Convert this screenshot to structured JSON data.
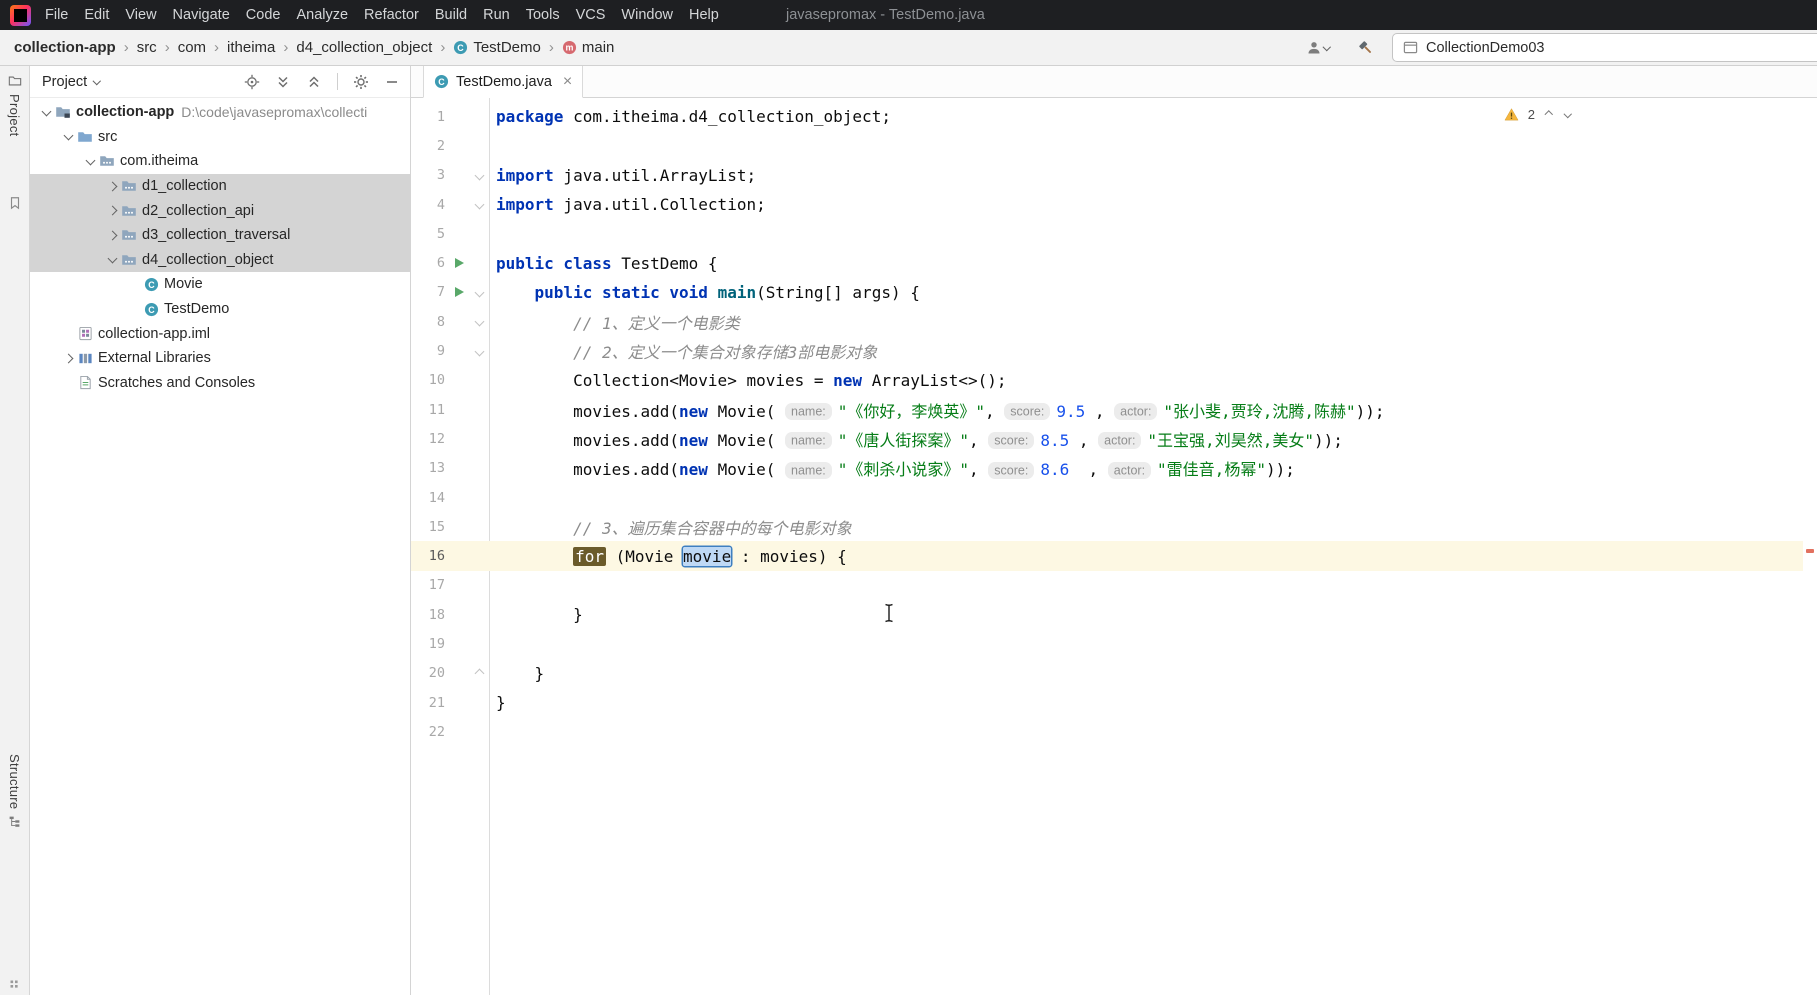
{
  "window": {
    "title": "javasepromax - TestDemo.java"
  },
  "menubar": {
    "items": [
      "File",
      "Edit",
      "View",
      "Navigate",
      "Code",
      "Analyze",
      "Refactor",
      "Build",
      "Run",
      "Tools",
      "VCS",
      "Window",
      "Help"
    ]
  },
  "navbar": {
    "breadcrumbs": [
      {
        "label": "collection-app",
        "bold": true
      },
      {
        "label": "src"
      },
      {
        "label": "com"
      },
      {
        "label": "itheima"
      },
      {
        "label": "d4_collection_object"
      },
      {
        "label": "TestDemo",
        "icon": "class"
      },
      {
        "label": "main",
        "icon": "method"
      }
    ],
    "run_config": "CollectionDemo03"
  },
  "tool_stripes": {
    "left_top": "Project",
    "left_bottom": "Structure"
  },
  "project_panel": {
    "title": "Project",
    "toolbar_icons": [
      "locate",
      "expand-all",
      "collapse-all",
      "divider",
      "settings",
      "hide"
    ],
    "tree": [
      {
        "label": "collection-app",
        "suffix": "D:\\code\\javasepromax\\collecti",
        "icon": "folder-project",
        "chevron": "expanded",
        "indent": 0,
        "bold": true
      },
      {
        "label": "src",
        "icon": "folder-src",
        "chevron": "expanded",
        "indent": 1
      },
      {
        "label": "com.itheima",
        "icon": "package",
        "chevron": "expanded",
        "indent": 2
      },
      {
        "label": "d1_collection",
        "icon": "package",
        "chevron": "collapsed",
        "indent": 3,
        "selected": true
      },
      {
        "label": "d2_collection_api",
        "icon": "package",
        "chevron": "collapsed",
        "indent": 3,
        "selected": true
      },
      {
        "label": "d3_collection_traversal",
        "icon": "package",
        "chevron": "collapsed",
        "indent": 3,
        "selected": true
      },
      {
        "label": "d4_collection_object",
        "icon": "package",
        "chevron": "expanded",
        "indent": 3,
        "selected": true
      },
      {
        "label": "Movie",
        "icon": "class",
        "chevron": "none",
        "indent": 4
      },
      {
        "label": "TestDemo",
        "icon": "class",
        "chevron": "none",
        "indent": 4
      },
      {
        "label": "collection-app.iml",
        "icon": "module-file",
        "chevron": "none",
        "indent": 1
      },
      {
        "label": "External Libraries",
        "icon": "library",
        "chevron": "collapsed",
        "indent": 1
      },
      {
        "label": "Scratches and Consoles",
        "icon": "scratches",
        "chevron": "none",
        "indent": 1
      }
    ]
  },
  "editor": {
    "tab": "TestDemo.java",
    "inspections": {
      "warning_count": "2"
    },
    "lines": [
      {
        "n": 1,
        "tokens": [
          {
            "t": "package",
            "c": "kw"
          },
          {
            "t": " com.itheima.d4_collection_object;",
            "c": "pl"
          }
        ]
      },
      {
        "n": 2,
        "tokens": []
      },
      {
        "n": 3,
        "fold": "down",
        "tokens": [
          {
            "t": "import",
            "c": "kw"
          },
          {
            "t": " java.util.ArrayList;",
            "c": "pl"
          }
        ]
      },
      {
        "n": 4,
        "fold": "down",
        "tokens": [
          {
            "t": "import",
            "c": "kw"
          },
          {
            "t": " java.util.Collection;",
            "c": "pl"
          }
        ]
      },
      {
        "n": 5,
        "tokens": []
      },
      {
        "n": 6,
        "run": true,
        "tokens": [
          {
            "t": "public class",
            "c": "kw"
          },
          {
            "t": " TestDemo {",
            "c": "pl"
          }
        ]
      },
      {
        "n": 7,
        "run": true,
        "fold": "down",
        "tokens": [
          {
            "t": "    ",
            "c": "pl"
          },
          {
            "t": "public static void",
            "c": "kw"
          },
          {
            "t": " ",
            "c": "pl"
          },
          {
            "t": "main",
            "c": "fn"
          },
          {
            "t": "(String[] args) {",
            "c": "pl"
          }
        ]
      },
      {
        "n": 8,
        "fold": "down",
        "tokens": [
          {
            "t": "        ",
            "c": "pl"
          },
          {
            "t": "// 1、定义一个电影类",
            "c": "cm"
          }
        ]
      },
      {
        "n": 9,
        "fold": "down",
        "tokens": [
          {
            "t": "        ",
            "c": "pl"
          },
          {
            "t": "// 2、定义一个集合对象存储3部电影对象",
            "c": "cm"
          }
        ]
      },
      {
        "n": 10,
        "tokens": [
          {
            "t": "        Collection<Movie> movies = ",
            "c": "pl"
          },
          {
            "t": "new",
            "c": "kw"
          },
          {
            "t": " ArrayList<>();",
            "c": "pl"
          }
        ]
      },
      {
        "n": 11,
        "tokens": [
          {
            "t": "        movies.add(",
            "c": "pl"
          },
          {
            "t": "new",
            "c": "kw"
          },
          {
            "t": " Movie( ",
            "c": "pl"
          },
          {
            "t": "name:",
            "c": "hint"
          },
          {
            "t": "\"《你好，李焕英》\"",
            "c": "st"
          },
          {
            "t": ", ",
            "c": "pl"
          },
          {
            "t": "score:",
            "c": "hint"
          },
          {
            "t": "9.5",
            "c": "nu"
          },
          {
            "t": " , ",
            "c": "pl"
          },
          {
            "t": "actor:",
            "c": "hint"
          },
          {
            "t": "\"张小斐,贾玲,沈腾,陈赫\"",
            "c": "st"
          },
          {
            "t": "));",
            "c": "pl"
          }
        ]
      },
      {
        "n": 12,
        "tokens": [
          {
            "t": "        movies.add(",
            "c": "pl"
          },
          {
            "t": "new",
            "c": "kw"
          },
          {
            "t": " Movie( ",
            "c": "pl"
          },
          {
            "t": "name:",
            "c": "hint"
          },
          {
            "t": "\"《唐人街探案》\"",
            "c": "st"
          },
          {
            "t": ", ",
            "c": "pl"
          },
          {
            "t": "score:",
            "c": "hint"
          },
          {
            "t": "8.5",
            "c": "nu"
          },
          {
            "t": " , ",
            "c": "pl"
          },
          {
            "t": "actor:",
            "c": "hint"
          },
          {
            "t": "\"王宝强,刘昊然,美女\"",
            "c": "st"
          },
          {
            "t": "));",
            "c": "pl"
          }
        ]
      },
      {
        "n": 13,
        "tokens": [
          {
            "t": "        movies.add(",
            "c": "pl"
          },
          {
            "t": "new",
            "c": "kw"
          },
          {
            "t": " Movie( ",
            "c": "pl"
          },
          {
            "t": "name:",
            "c": "hint"
          },
          {
            "t": "\"《刺杀小说家》\"",
            "c": "st"
          },
          {
            "t": ", ",
            "c": "pl"
          },
          {
            "t": "score:",
            "c": "hint"
          },
          {
            "t": "8.6",
            "c": "nu"
          },
          {
            "t": "  , ",
            "c": "pl"
          },
          {
            "t": "actor:",
            "c": "hint"
          },
          {
            "t": "\"雷佳音,杨幂\"",
            "c": "st"
          },
          {
            "t": "));",
            "c": "pl"
          }
        ]
      },
      {
        "n": 14,
        "tokens": []
      },
      {
        "n": 15,
        "tokens": [
          {
            "t": "        ",
            "c": "pl"
          },
          {
            "t": "// 3、遍历集合容器中的每个电影对象",
            "c": "cm"
          }
        ]
      },
      {
        "n": 16,
        "caret": true,
        "tokens": [
          {
            "t": "        ",
            "c": "pl"
          },
          {
            "t": "for",
            "c": "forhl"
          },
          {
            "t": " (Movie ",
            "c": "pl"
          },
          {
            "t": "movie",
            "c": "sel"
          },
          {
            "t": " : movies) {",
            "c": "pl"
          }
        ]
      },
      {
        "n": 17,
        "tokens": []
      },
      {
        "n": 18,
        "tokens": [
          {
            "t": "        }",
            "c": "pl"
          }
        ]
      },
      {
        "n": 19,
        "tokens": []
      },
      {
        "n": 20,
        "fold": "up",
        "tokens": [
          {
            "t": "    }",
            "c": "pl"
          }
        ]
      },
      {
        "n": 21,
        "tokens": [
          {
            "t": "}",
            "c": "pl"
          }
        ]
      },
      {
        "n": 22,
        "tokens": []
      }
    ]
  },
  "colors": {
    "keyword": "#0033b3",
    "string": "#067d17",
    "number": "#1750eb",
    "comment": "#8c8c8c",
    "method": "#00627a",
    "caret_line": "#fdf8e3",
    "for_highlight_bg": "#6b5b2a",
    "selection_bg": "#bfd9f5",
    "selection_border": "#3e7fc1",
    "run_icon": "#59a869",
    "warning": "#f5b63e",
    "tree_selection": "#d4d4d4"
  },
  "cursor": "ibeam"
}
